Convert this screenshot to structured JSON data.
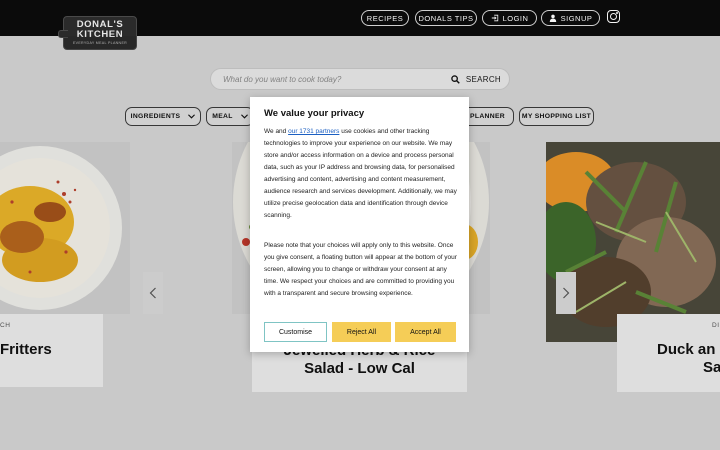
{
  "header": {
    "logo": {
      "line1": "DONAL'S",
      "line2": "KITCHEN",
      "line3": "EVERYDAY MEAL PLANNER"
    },
    "nav": [
      {
        "label": "RECIPES",
        "icon": null
      },
      {
        "label": "DONALS TIPS",
        "icon": null
      },
      {
        "label": "LOGIN",
        "icon": "login-icon"
      },
      {
        "label": "SIGNUP",
        "icon": "user-icon"
      }
    ],
    "social_icon": "instagram-icon"
  },
  "search": {
    "placeholder": "What do you want to cook today?",
    "button_label": "SEARCH"
  },
  "filters": [
    {
      "label": "INGREDIENTS"
    },
    {
      "label": "MEAL"
    },
    {
      "label": "AL PLANNER"
    },
    {
      "label": "MY SHOPPING LIST"
    }
  ],
  "cards": [
    {
      "tag": "CH",
      "title_line1": "Fritters",
      "title_line2": ""
    },
    {
      "tag": "",
      "title_line1": "Jewelled Herb & Rice",
      "title_line2": "Salad - Low Cal"
    },
    {
      "tag": "DI",
      "title_line1": "Duck an",
      "title_line2": "Sa"
    }
  ],
  "consent": {
    "title": "We value your privacy",
    "p1_before_link": "We and ",
    "p1_link": "our 1731 partners",
    "p1_after_link": " use cookies and other tracking technologies to improve your experience on our website. We may store and/or access information on a device and process personal data, such as your IP address and browsing data, for personalised advertising and content, advertising and content measurement, audience research and services development. Additionally, we may utilize precise geolocation data and identification through device scanning.",
    "p2": "Please note that your choices will apply only to this website. Once you give consent, a floating button will appear at the bottom of your screen, allowing you to change or withdraw your consent at any time. We respect your choices and are committed to providing you with a transparent and secure browsing experience.",
    "buttons": {
      "customise": "Customise",
      "reject": "Reject All",
      "accept": "Accept All"
    }
  },
  "colors": {
    "header_bg": "#0b0b0b",
    "accept_yellow": "#f5cd57",
    "link_blue": "#1b5fc2"
  }
}
